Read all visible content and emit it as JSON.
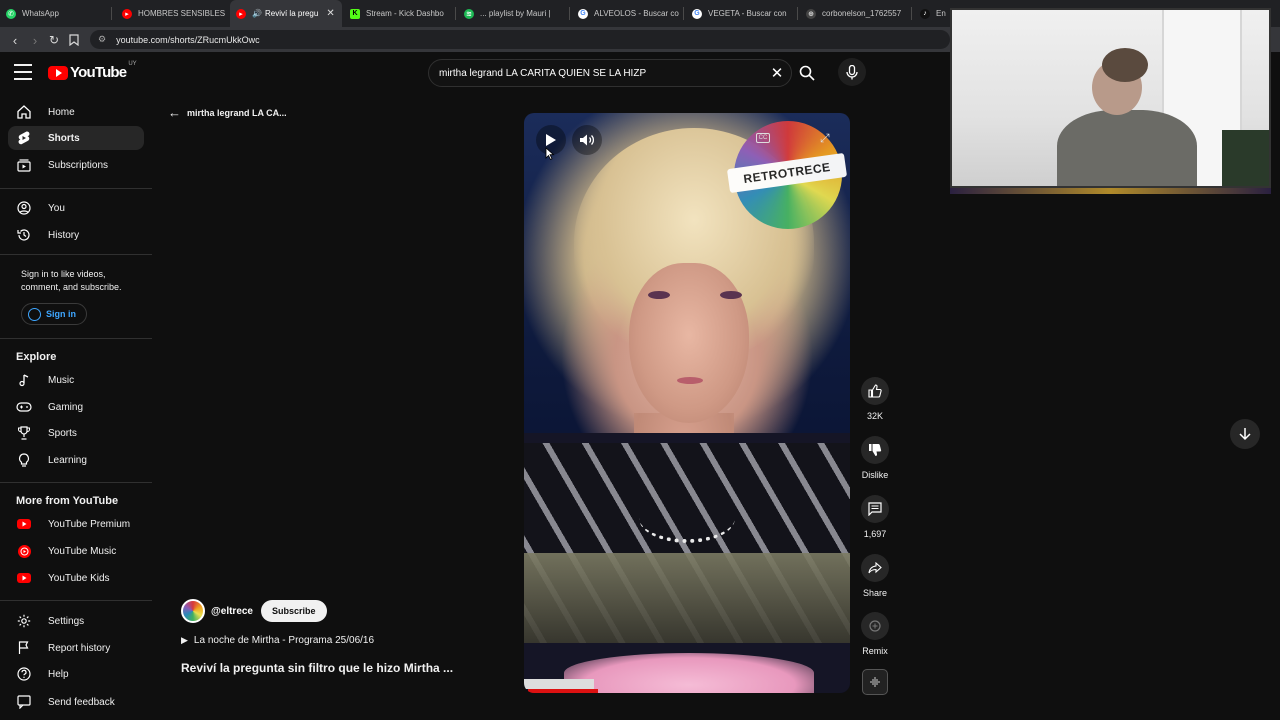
{
  "browser": {
    "tabs": [
      {
        "label": "WhatsApp",
        "icon": "whatsapp-icon",
        "color": "#25d366"
      },
      {
        "label": "HOMBRES SENSIBLES",
        "icon": "youtube-icon",
        "color": "#ff0000"
      },
      {
        "label": "Reviví la pregu",
        "icon": "youtube-icon",
        "color": "#ff0000",
        "active": true
      },
      {
        "label": "Stream - Kick Dashbo",
        "icon": "kick-icon",
        "color": "#53fc18"
      },
      {
        "label": "... playlist by Mauri |",
        "icon": "spotify-icon",
        "color": "#1db954"
      },
      {
        "label": "ALVEOLOS - Buscar co",
        "icon": "google-icon",
        "color": "#ffffff"
      },
      {
        "label": "VEGETA - Buscar con",
        "icon": "google-icon",
        "color": "#ffffff"
      },
      {
        "label": "corbonelson_1762557",
        "icon": "link-icon",
        "color": "#aaaaaa"
      },
      {
        "label": "En",
        "icon": "tiktok-icon",
        "color": "#000000"
      }
    ],
    "url": "youtube.com/shorts/ZRucmUkkOwc"
  },
  "header": {
    "logo_text": "YouTube",
    "country_code": "UY",
    "search_query": "mirtha legrand  LA CARITA QUIEN SE LA HIZP"
  },
  "sidebar": {
    "main": [
      {
        "label": "Home",
        "icon": "home-icon"
      },
      {
        "label": "Shorts",
        "icon": "shorts-icon",
        "active": true
      },
      {
        "label": "Subscriptions",
        "icon": "subscriptions-icon"
      }
    ],
    "you": [
      {
        "label": "You",
        "icon": "you-icon"
      },
      {
        "label": "History",
        "icon": "history-icon"
      }
    ],
    "signin_note": "Sign in to like videos, comment, and subscribe.",
    "signin_label": "Sign in",
    "explore_heading": "Explore",
    "explore": [
      {
        "label": "Music",
        "icon": "music-icon"
      },
      {
        "label": "Gaming",
        "icon": "gaming-icon"
      },
      {
        "label": "Sports",
        "icon": "sports-icon"
      },
      {
        "label": "Learning",
        "icon": "learning-icon"
      }
    ],
    "more_heading": "More from YouTube",
    "more": [
      {
        "label": "YouTube Premium",
        "icon": "youtube-premium-icon"
      },
      {
        "label": "YouTube Music",
        "icon": "youtube-music-icon"
      },
      {
        "label": "YouTube Kids",
        "icon": "youtube-kids-icon"
      }
    ],
    "bottom": [
      {
        "label": "Settings",
        "icon": "settings-icon"
      },
      {
        "label": "Report history",
        "icon": "flag-icon"
      },
      {
        "label": "Help",
        "icon": "help-icon"
      },
      {
        "label": "Send feedback",
        "icon": "feedback-icon"
      }
    ]
  },
  "shorts": {
    "back_title": "mirtha legrand LA CA...",
    "channel_handle": "@eltrece",
    "subscribe_label": "Subscribe",
    "playlist": "La noche de Mirtha - Programa 25/06/16",
    "title": "Reviví la pregunta sin filtro que le hizo Mirtha ...",
    "overlay_badge": "RETROTRECE",
    "actions": {
      "likes": "32K",
      "dislike_label": "Dislike",
      "comments": "1,697",
      "share_label": "Share",
      "remix_label": "Remix"
    }
  },
  "colors": {
    "accent_red": "#ff0000",
    "link_blue": "#3ea6ff",
    "bg": "#0f0f0f"
  }
}
